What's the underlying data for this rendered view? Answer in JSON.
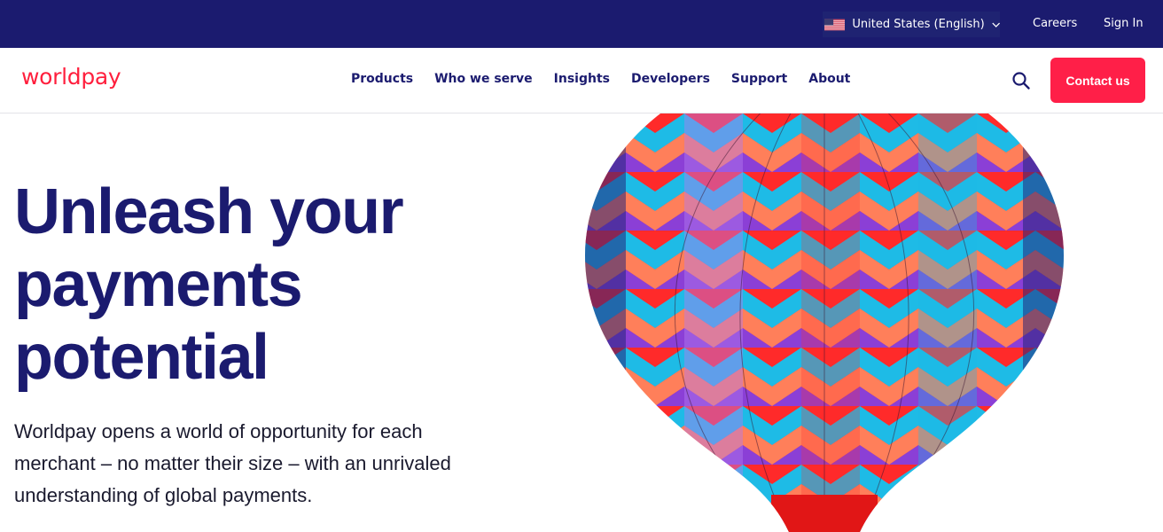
{
  "topbar": {
    "locale_label": "United States (English)",
    "locale_flag": "us-flag-icon",
    "careers": "Careers",
    "sign_in": "Sign In",
    "bg_color": "#1b1b6f"
  },
  "header": {
    "logo": "worldpay",
    "logo_color": "#ff1f3d",
    "nav": [
      "Products",
      "Who we serve",
      "Insights",
      "Developers",
      "Support",
      "About"
    ],
    "search_icon": "search-icon",
    "contact_label": "Contact us",
    "contact_color": "#ff1f48"
  },
  "hero": {
    "title": "Unleash your payments potential",
    "body": "Worldpay opens a world of opportunity for each merchant – no matter their size – with an unrivaled understanding of global payments.",
    "image": "hot-air-balloon-image"
  }
}
